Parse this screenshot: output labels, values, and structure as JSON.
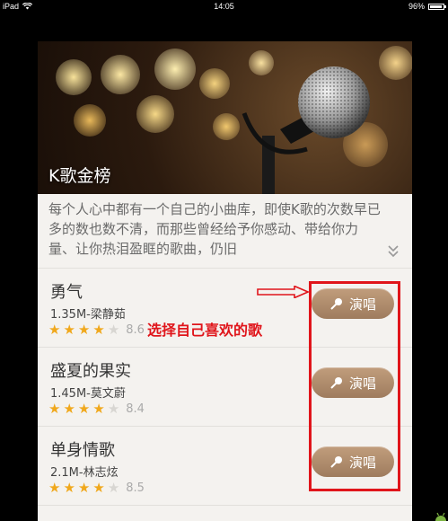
{
  "status_bar": {
    "device": "iPad",
    "time": "14:05",
    "battery": "96%",
    "battery_level": 0.96
  },
  "header": {
    "title": "K歌金榜"
  },
  "description": {
    "text": "每个人心中都有一个自己的小曲库，即使K歌的次数早已多的数也数不清，而那些曾经给予你感动、带给你力量、让你热泪盈眶的歌曲，仍旧"
  },
  "songs": [
    {
      "title": "勇气",
      "meta": "1.35M-梁静茹",
      "stars": 4,
      "score": "8.6",
      "button_label": "演唱"
    },
    {
      "title": "盛夏的果实",
      "meta": "1.45M-莫文蔚",
      "stars": 4,
      "score": "8.4",
      "button_label": "演唱"
    },
    {
      "title": "单身情歌",
      "meta": "2.1M-林志炫",
      "stars": 4,
      "score": "8.5",
      "button_label": "演唱"
    }
  ],
  "annotation": {
    "text": "选择自己喜欢的歌",
    "color": "#e0151b"
  },
  "colors": {
    "button": "#a98466",
    "star": "#f0a81c"
  }
}
